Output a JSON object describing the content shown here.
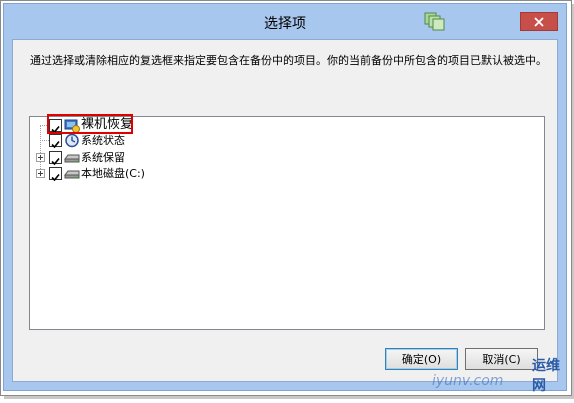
{
  "window": {
    "title": "选择项",
    "close_icon": "close-icon",
    "app_icon": "windows-stack-icon"
  },
  "description": "通过选择或清除相应的复选框来指定要包含在备份中的项目。你的当前备份中所包含的项目已默认被选中。",
  "tree": {
    "items": [
      {
        "label": "裸机恢复",
        "checked": true,
        "expandable": false,
        "icon": "computer-recovery-icon"
      },
      {
        "label": "系统状态",
        "checked": true,
        "expandable": false,
        "icon": "system-state-icon"
      },
      {
        "label": "系统保留",
        "checked": true,
        "expandable": true,
        "icon": "drive-icon"
      },
      {
        "label": "本地磁盘(C:)",
        "checked": true,
        "expandable": true,
        "icon": "drive-icon"
      }
    ]
  },
  "buttons": {
    "ok_label": "确定(O)",
    "cancel_label": "取消(C)"
  },
  "watermark": {
    "brand": "运维网",
    "url": "iyunv.com"
  },
  "colors": {
    "title_bar": "#a8c7ee",
    "close_button": "#c74f4a",
    "highlight": "#e10000"
  }
}
